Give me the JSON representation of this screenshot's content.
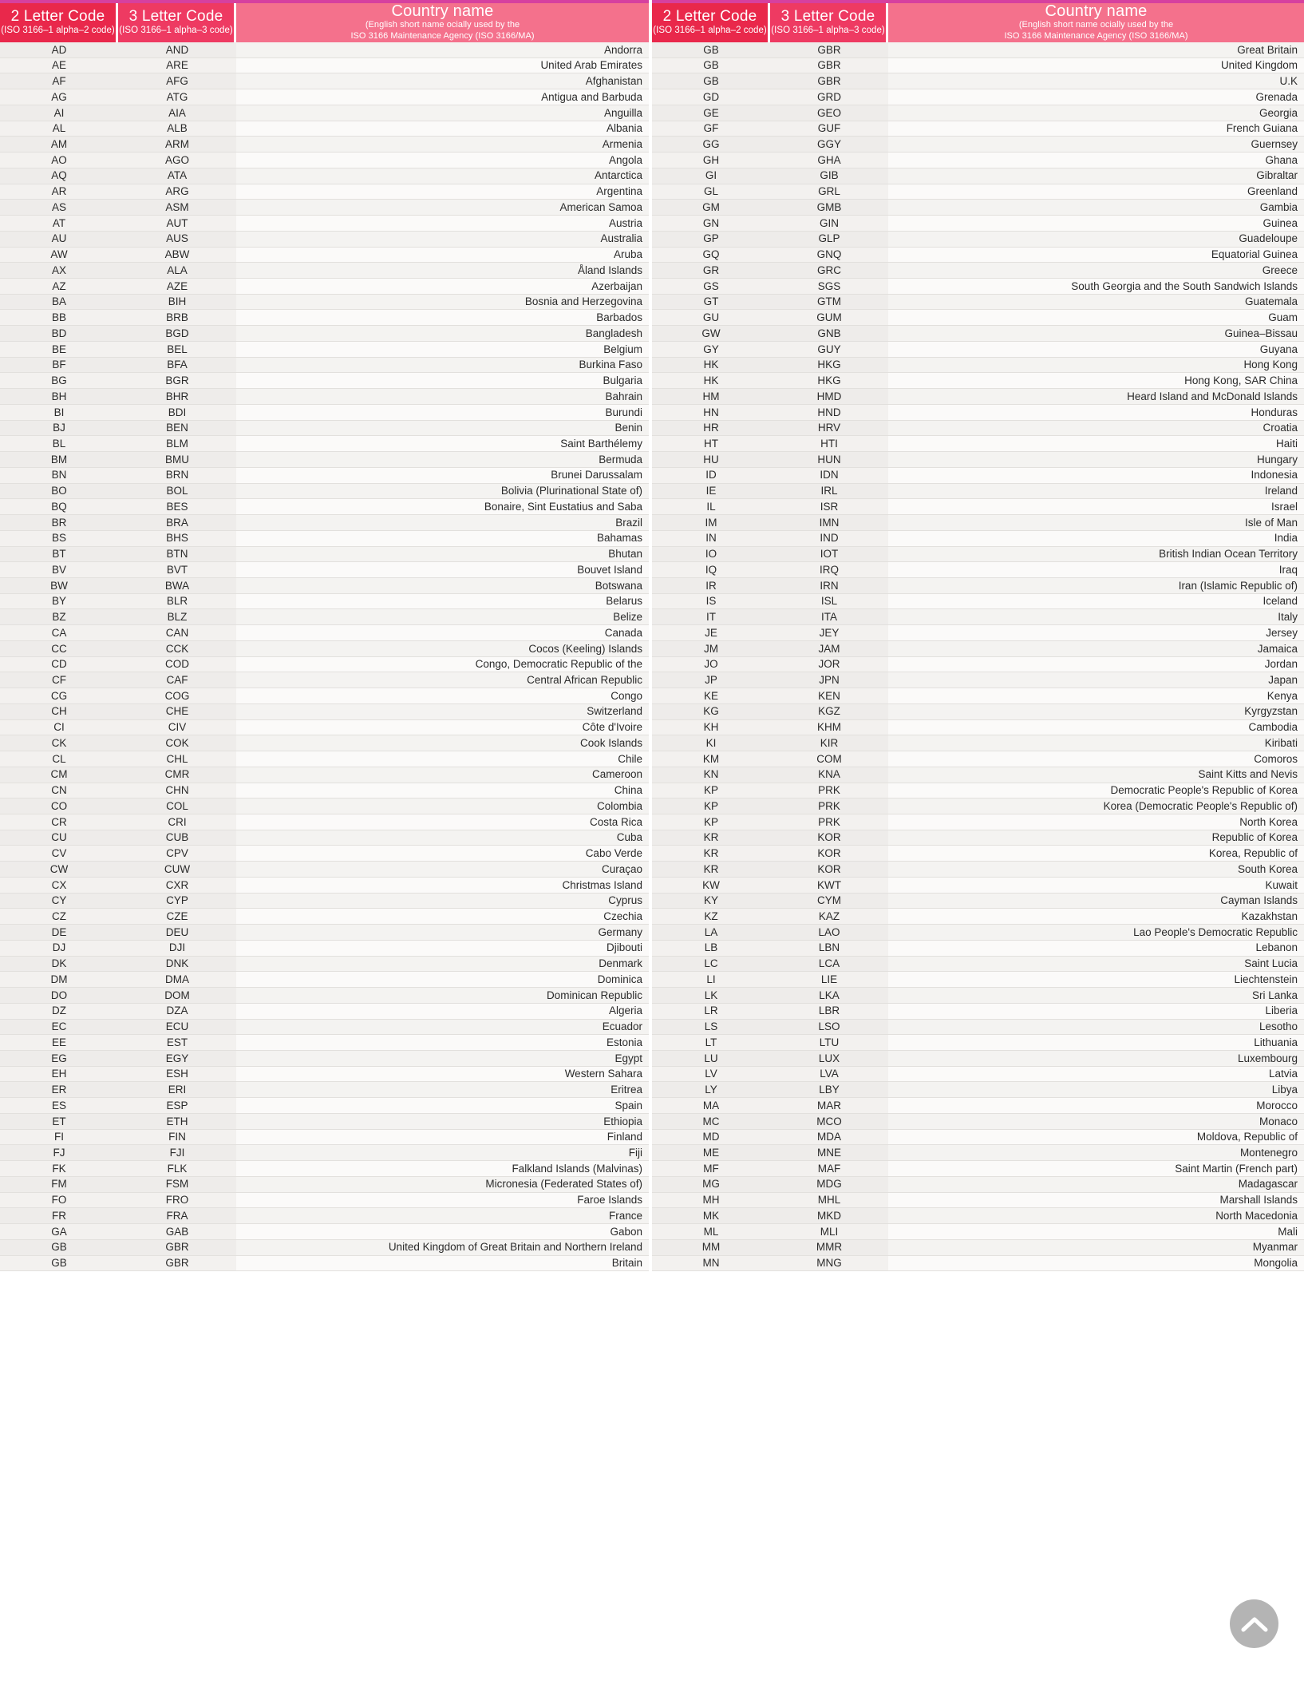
{
  "page": {
    "title": "ISO 3166 Country Codes",
    "accent_header_code2": "#e9284b",
    "accent_header_code3": "#ee3a62",
    "accent_header_country": "#f4718c",
    "accent_top_strip": "#d6409f",
    "row_stripe_a": "#eeecea",
    "row_stripe_b": "#fbfaf9"
  },
  "columns": {
    "code2_title": "2 Letter Code",
    "code2_sub": "(ISO 3166–1 alpha–2 code)",
    "code3_title": "3 Letter Code",
    "code3_sub": "(ISO 3166–1 alpha–3 code)",
    "country_title": "Country name",
    "country_sub1": "(English short name ocially used by the",
    "country_sub2": "ISO 3166 Maintenance Agency (ISO 3166/MA)"
  },
  "scroll_top": {
    "label": "scroll-to-top",
    "glyph": "chevron-up"
  },
  "left_rows": [
    {
      "c2": "AD",
      "c3": "AND",
      "name": "Andorra"
    },
    {
      "c2": "AE",
      "c3": "ARE",
      "name": "United Arab Emirates"
    },
    {
      "c2": "AF",
      "c3": "AFG",
      "name": "Afghanistan"
    },
    {
      "c2": "AG",
      "c3": "ATG",
      "name": "Antigua and Barbuda"
    },
    {
      "c2": "AI",
      "c3": "AIA",
      "name": "Anguilla"
    },
    {
      "c2": "AL",
      "c3": "ALB",
      "name": "Albania"
    },
    {
      "c2": "AM",
      "c3": "ARM",
      "name": "Armenia"
    },
    {
      "c2": "AO",
      "c3": "AGO",
      "name": "Angola"
    },
    {
      "c2": "AQ",
      "c3": "ATA",
      "name": "Antarctica"
    },
    {
      "c2": "AR",
      "c3": "ARG",
      "name": "Argentina"
    },
    {
      "c2": "AS",
      "c3": "ASM",
      "name": "American Samoa"
    },
    {
      "c2": "AT",
      "c3": "AUT",
      "name": "Austria"
    },
    {
      "c2": "AU",
      "c3": "AUS",
      "name": "Australia"
    },
    {
      "c2": "AW",
      "c3": "ABW",
      "name": "Aruba"
    },
    {
      "c2": "AX",
      "c3": "ALA",
      "name": "Åland Islands"
    },
    {
      "c2": "AZ",
      "c3": "AZE",
      "name": "Azerbaijan"
    },
    {
      "c2": "BA",
      "c3": "BIH",
      "name": "Bosnia and Herzegovina"
    },
    {
      "c2": "BB",
      "c3": "BRB",
      "name": "Barbados"
    },
    {
      "c2": "BD",
      "c3": "BGD",
      "name": "Bangladesh"
    },
    {
      "c2": "BE",
      "c3": "BEL",
      "name": "Belgium"
    },
    {
      "c2": "BF",
      "c3": "BFA",
      "name": "Burkina Faso"
    },
    {
      "c2": "BG",
      "c3": "BGR",
      "name": "Bulgaria"
    },
    {
      "c2": "BH",
      "c3": "BHR",
      "name": "Bahrain"
    },
    {
      "c2": "BI",
      "c3": "BDI",
      "name": "Burundi"
    },
    {
      "c2": "BJ",
      "c3": "BEN",
      "name": "Benin"
    },
    {
      "c2": "BL",
      "c3": "BLM",
      "name": "Saint Barthélemy"
    },
    {
      "c2": "BM",
      "c3": "BMU",
      "name": "Bermuda"
    },
    {
      "c2": "BN",
      "c3": "BRN",
      "name": "Brunei Darussalam"
    },
    {
      "c2": "BO",
      "c3": "BOL",
      "name": "Bolivia (Plurinational State of)"
    },
    {
      "c2": "BQ",
      "c3": "BES",
      "name": "Bonaire, Sint Eustatius and Saba"
    },
    {
      "c2": "BR",
      "c3": "BRA",
      "name": "Brazil"
    },
    {
      "c2": "BS",
      "c3": "BHS",
      "name": "Bahamas"
    },
    {
      "c2": "BT",
      "c3": "BTN",
      "name": "Bhutan"
    },
    {
      "c2": "BV",
      "c3": "BVT",
      "name": "Bouvet Island"
    },
    {
      "c2": "BW",
      "c3": "BWA",
      "name": "Botswana"
    },
    {
      "c2": "BY",
      "c3": "BLR",
      "name": "Belarus"
    },
    {
      "c2": "BZ",
      "c3": "BLZ",
      "name": "Belize"
    },
    {
      "c2": "CA",
      "c3": "CAN",
      "name": "Canada"
    },
    {
      "c2": "CC",
      "c3": "CCK",
      "name": "Cocos (Keeling) Islands"
    },
    {
      "c2": "CD",
      "c3": "COD",
      "name": "Congo, Democratic Republic of the"
    },
    {
      "c2": "CF",
      "c3": "CAF",
      "name": "Central African Republic"
    },
    {
      "c2": "CG",
      "c3": "COG",
      "name": "Congo"
    },
    {
      "c2": "CH",
      "c3": "CHE",
      "name": "Switzerland"
    },
    {
      "c2": "CI",
      "c3": "CIV",
      "name": "Côte d'Ivoire"
    },
    {
      "c2": "CK",
      "c3": "COK",
      "name": "Cook Islands"
    },
    {
      "c2": "CL",
      "c3": "CHL",
      "name": "Chile"
    },
    {
      "c2": "CM",
      "c3": "CMR",
      "name": "Cameroon"
    },
    {
      "c2": "CN",
      "c3": "CHN",
      "name": "China"
    },
    {
      "c2": "CO",
      "c3": "COL",
      "name": "Colombia"
    },
    {
      "c2": "CR",
      "c3": "CRI",
      "name": "Costa Rica"
    },
    {
      "c2": "CU",
      "c3": "CUB",
      "name": "Cuba"
    },
    {
      "c2": "CV",
      "c3": "CPV",
      "name": "Cabo Verde"
    },
    {
      "c2": "CW",
      "c3": "CUW",
      "name": "Curaçao"
    },
    {
      "c2": "CX",
      "c3": "CXR",
      "name": "Christmas Island"
    },
    {
      "c2": "CY",
      "c3": "CYP",
      "name": "Cyprus"
    },
    {
      "c2": "CZ",
      "c3": "CZE",
      "name": "Czechia"
    },
    {
      "c2": "DE",
      "c3": "DEU",
      "name": "Germany"
    },
    {
      "c2": "DJ",
      "c3": "DJI",
      "name": "Djibouti"
    },
    {
      "c2": "DK",
      "c3": "DNK",
      "name": "Denmark"
    },
    {
      "c2": "DM",
      "c3": "DMA",
      "name": "Dominica"
    },
    {
      "c2": "DO",
      "c3": "DOM",
      "name": "Dominican Republic"
    },
    {
      "c2": "DZ",
      "c3": "DZA",
      "name": "Algeria"
    },
    {
      "c2": "EC",
      "c3": "ECU",
      "name": "Ecuador"
    },
    {
      "c2": "EE",
      "c3": "EST",
      "name": "Estonia"
    },
    {
      "c2": "EG",
      "c3": "EGY",
      "name": "Egypt"
    },
    {
      "c2": "EH",
      "c3": "ESH",
      "name": "Western Sahara"
    },
    {
      "c2": "ER",
      "c3": "ERI",
      "name": "Eritrea"
    },
    {
      "c2": "ES",
      "c3": "ESP",
      "name": "Spain"
    },
    {
      "c2": "ET",
      "c3": "ETH",
      "name": "Ethiopia"
    },
    {
      "c2": "FI",
      "c3": "FIN",
      "name": "Finland"
    },
    {
      "c2": "FJ",
      "c3": "FJI",
      "name": "Fiji"
    },
    {
      "c2": "FK",
      "c3": "FLK",
      "name": "Falkland Islands (Malvinas)"
    },
    {
      "c2": "FM",
      "c3": "FSM",
      "name": "Micronesia (Federated States of)"
    },
    {
      "c2": "FO",
      "c3": "FRO",
      "name": "Faroe Islands"
    },
    {
      "c2": "FR",
      "c3": "FRA",
      "name": "France"
    },
    {
      "c2": "GA",
      "c3": "GAB",
      "name": "Gabon"
    },
    {
      "c2": "GB",
      "c3": "GBR",
      "name": "United Kingdom of Great Britain and Northern Ireland"
    },
    {
      "c2": "GB",
      "c3": "GBR",
      "name": "Britain"
    }
  ],
  "right_rows": [
    {
      "c2": "GB",
      "c3": "GBR",
      "name": "Great Britain"
    },
    {
      "c2": "GB",
      "c3": "GBR",
      "name": "United Kingdom"
    },
    {
      "c2": "GB",
      "c3": "GBR",
      "name": "U.K"
    },
    {
      "c2": "GD",
      "c3": "GRD",
      "name": "Grenada"
    },
    {
      "c2": "GE",
      "c3": "GEO",
      "name": "Georgia"
    },
    {
      "c2": "GF",
      "c3": "GUF",
      "name": "French Guiana"
    },
    {
      "c2": "GG",
      "c3": "GGY",
      "name": "Guernsey"
    },
    {
      "c2": "GH",
      "c3": "GHA",
      "name": "Ghana"
    },
    {
      "c2": "GI",
      "c3": "GIB",
      "name": "Gibraltar"
    },
    {
      "c2": "GL",
      "c3": "GRL",
      "name": "Greenland"
    },
    {
      "c2": "GM",
      "c3": "GMB",
      "name": "Gambia"
    },
    {
      "c2": "GN",
      "c3": "GIN",
      "name": "Guinea"
    },
    {
      "c2": "GP",
      "c3": "GLP",
      "name": "Guadeloupe"
    },
    {
      "c2": "GQ",
      "c3": "GNQ",
      "name": "Equatorial Guinea"
    },
    {
      "c2": "GR",
      "c3": "GRC",
      "name": "Greece"
    },
    {
      "c2": "GS",
      "c3": "SGS",
      "name": "South Georgia and the South Sandwich Islands"
    },
    {
      "c2": "GT",
      "c3": "GTM",
      "name": "Guatemala"
    },
    {
      "c2": "GU",
      "c3": "GUM",
      "name": "Guam"
    },
    {
      "c2": "GW",
      "c3": "GNB",
      "name": "Guinea–Bissau"
    },
    {
      "c2": "GY",
      "c3": "GUY",
      "name": "Guyana"
    },
    {
      "c2": "HK",
      "c3": "HKG",
      "name": "Hong Kong"
    },
    {
      "c2": "HK",
      "c3": "HKG",
      "name": "Hong Kong, SAR China"
    },
    {
      "c2": "HM",
      "c3": "HMD",
      "name": "Heard Island and McDonald Islands"
    },
    {
      "c2": "HN",
      "c3": "HND",
      "name": "Honduras"
    },
    {
      "c2": "HR",
      "c3": "HRV",
      "name": "Croatia"
    },
    {
      "c2": "HT",
      "c3": "HTI",
      "name": "Haiti"
    },
    {
      "c2": "HU",
      "c3": "HUN",
      "name": "Hungary"
    },
    {
      "c2": "ID",
      "c3": "IDN",
      "name": "Indonesia"
    },
    {
      "c2": "IE",
      "c3": "IRL",
      "name": "Ireland"
    },
    {
      "c2": "IL",
      "c3": "ISR",
      "name": "Israel"
    },
    {
      "c2": "IM",
      "c3": "IMN",
      "name": "Isle of Man"
    },
    {
      "c2": "IN",
      "c3": "IND",
      "name": "India"
    },
    {
      "c2": "IO",
      "c3": "IOT",
      "name": "British Indian Ocean Territory"
    },
    {
      "c2": "IQ",
      "c3": "IRQ",
      "name": "Iraq"
    },
    {
      "c2": "IR",
      "c3": "IRN",
      "name": "Iran (Islamic Republic of)"
    },
    {
      "c2": "IS",
      "c3": "ISL",
      "name": "Iceland"
    },
    {
      "c2": "IT",
      "c3": "ITA",
      "name": "Italy"
    },
    {
      "c2": "JE",
      "c3": "JEY",
      "name": "Jersey"
    },
    {
      "c2": "JM",
      "c3": "JAM",
      "name": "Jamaica"
    },
    {
      "c2": "JO",
      "c3": "JOR",
      "name": "Jordan"
    },
    {
      "c2": "JP",
      "c3": "JPN",
      "name": "Japan"
    },
    {
      "c2": "KE",
      "c3": "KEN",
      "name": "Kenya"
    },
    {
      "c2": "KG",
      "c3": "KGZ",
      "name": "Kyrgyzstan"
    },
    {
      "c2": "KH",
      "c3": "KHM",
      "name": "Cambodia"
    },
    {
      "c2": "KI",
      "c3": "KIR",
      "name": "Kiribati"
    },
    {
      "c2": "KM",
      "c3": "COM",
      "name": "Comoros"
    },
    {
      "c2": "KN",
      "c3": "KNA",
      "name": "Saint Kitts and Nevis"
    },
    {
      "c2": "KP",
      "c3": "PRK",
      "name": "Democratic People's Republic of Korea"
    },
    {
      "c2": "KP",
      "c3": "PRK",
      "name": "Korea (Democratic People's Republic of)"
    },
    {
      "c2": "KP",
      "c3": "PRK",
      "name": "North Korea"
    },
    {
      "c2": "KR",
      "c3": "KOR",
      "name": "Republic of Korea"
    },
    {
      "c2": "KR",
      "c3": "KOR",
      "name": "Korea, Republic of"
    },
    {
      "c2": "KR",
      "c3": "KOR",
      "name": "South Korea"
    },
    {
      "c2": "KW",
      "c3": "KWT",
      "name": "Kuwait"
    },
    {
      "c2": "KY",
      "c3": "CYM",
      "name": "Cayman Islands"
    },
    {
      "c2": "KZ",
      "c3": "KAZ",
      "name": "Kazakhstan"
    },
    {
      "c2": "LA",
      "c3": "LAO",
      "name": "Lao People's Democratic Republic"
    },
    {
      "c2": "LB",
      "c3": "LBN",
      "name": "Lebanon"
    },
    {
      "c2": "LC",
      "c3": "LCA",
      "name": "Saint Lucia"
    },
    {
      "c2": "LI",
      "c3": "LIE",
      "name": "Liechtenstein"
    },
    {
      "c2": "LK",
      "c3": "LKA",
      "name": "Sri Lanka"
    },
    {
      "c2": "LR",
      "c3": "LBR",
      "name": "Liberia"
    },
    {
      "c2": "LS",
      "c3": "LSO",
      "name": "Lesotho"
    },
    {
      "c2": "LT",
      "c3": "LTU",
      "name": "Lithuania"
    },
    {
      "c2": "LU",
      "c3": "LUX",
      "name": "Luxembourg"
    },
    {
      "c2": "LV",
      "c3": "LVA",
      "name": "Latvia"
    },
    {
      "c2": "LY",
      "c3": "LBY",
      "name": "Libya"
    },
    {
      "c2": "MA",
      "c3": "MAR",
      "name": "Morocco"
    },
    {
      "c2": "MC",
      "c3": "MCO",
      "name": "Monaco"
    },
    {
      "c2": "MD",
      "c3": "MDA",
      "name": "Moldova, Republic of"
    },
    {
      "c2": "ME",
      "c3": "MNE",
      "name": "Montenegro"
    },
    {
      "c2": "MF",
      "c3": "MAF",
      "name": "Saint Martin (French part)"
    },
    {
      "c2": "MG",
      "c3": "MDG",
      "name": "Madagascar"
    },
    {
      "c2": "MH",
      "c3": "MHL",
      "name": "Marshall Islands"
    },
    {
      "c2": "MK",
      "c3": "MKD",
      "name": "North Macedonia"
    },
    {
      "c2": "ML",
      "c3": "MLI",
      "name": "Mali"
    },
    {
      "c2": "MM",
      "c3": "MMR",
      "name": "Myanmar"
    },
    {
      "c2": "MN",
      "c3": "MNG",
      "name": "Mongolia"
    }
  ]
}
